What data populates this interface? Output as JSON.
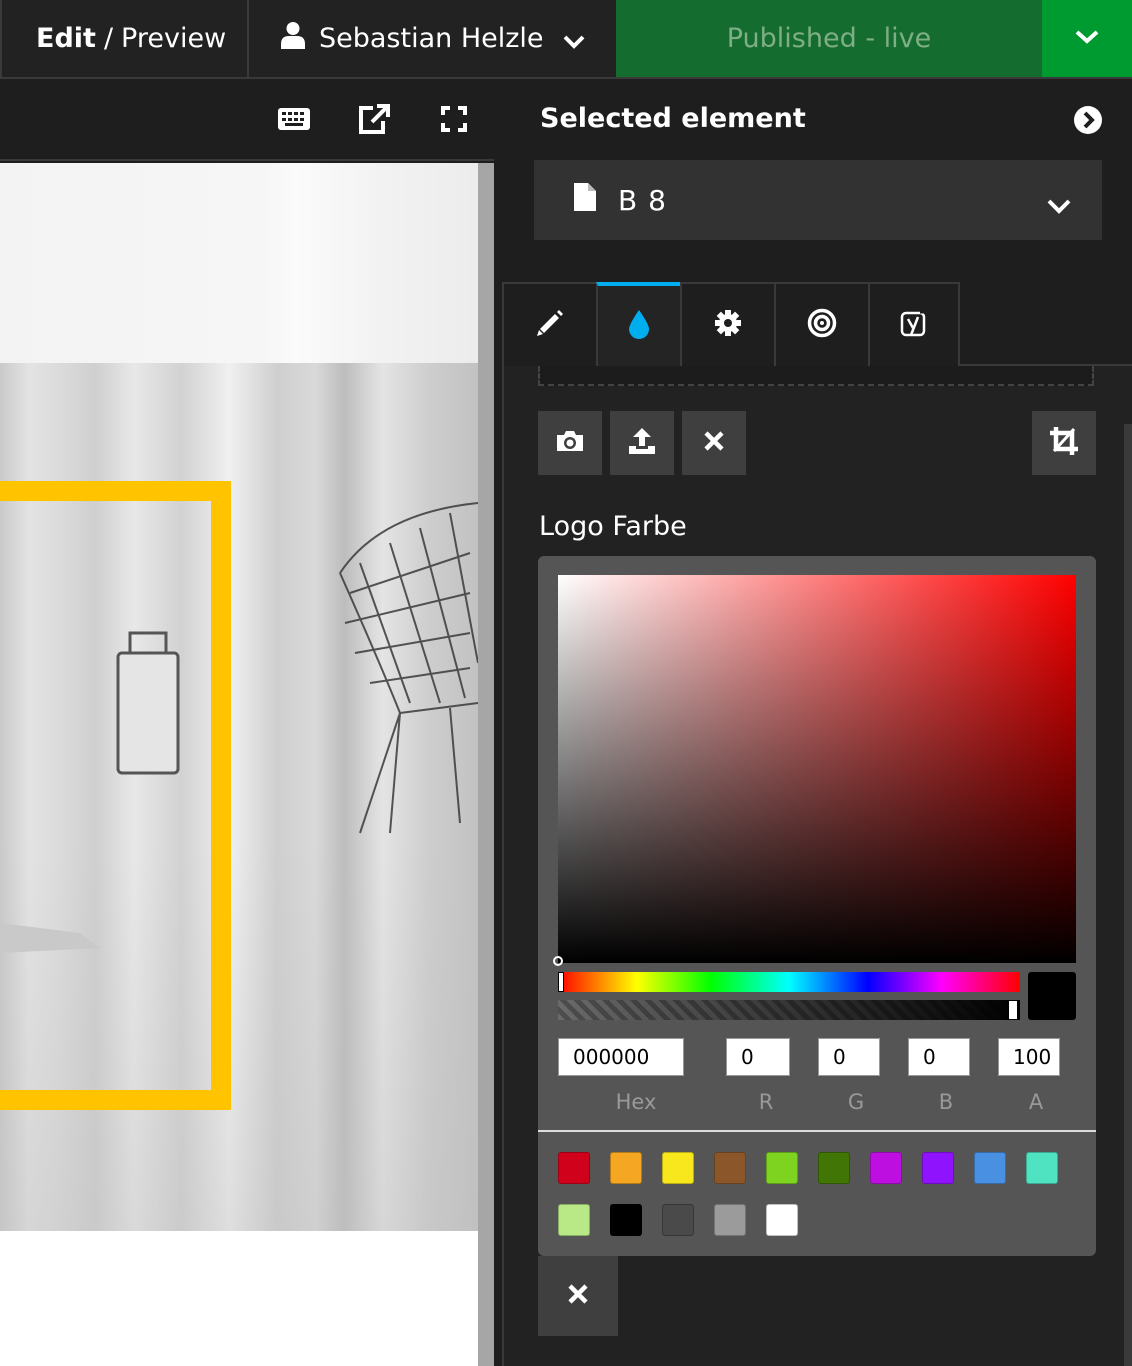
{
  "topbar": {
    "edit_label": "Edit",
    "sep": "/",
    "preview_label": "Preview",
    "user_name": "Sebastian Helzle",
    "publish_status": "Published - live"
  },
  "toolbar": {
    "icons": [
      "keyboard-icon",
      "external-link-icon",
      "fullscreen-icon"
    ]
  },
  "panel": {
    "title": "Selected element",
    "node_name": "B 8",
    "tabs": [
      "pencil-icon",
      "water-drop-icon",
      "gear-icon",
      "target-icon",
      "yoast-icon"
    ],
    "active_tab": 1,
    "field_label": "Logo Farbe",
    "accent": "#00adee"
  },
  "color_picker": {
    "hex": "000000",
    "r": "0",
    "g": "0",
    "b": "0",
    "a": "100",
    "labels": {
      "hex": "Hex",
      "r": "R",
      "g": "G",
      "b": "B",
      "a": "A"
    },
    "presets": [
      "#d0021b",
      "#f5a623",
      "#f8e71c",
      "#8b572a",
      "#7ed321",
      "#417505",
      "#bd10e0",
      "#9013fe",
      "#4a90e2",
      "#50e3c2",
      "#b8e986",
      "#000000",
      "#4a4a4a",
      "#9b9b9b",
      "#ffffff"
    ]
  },
  "colors": {
    "published_bg": "#146c2f",
    "publish_menu_bg": "#009b30",
    "frame_yellow": "#ffc300"
  }
}
